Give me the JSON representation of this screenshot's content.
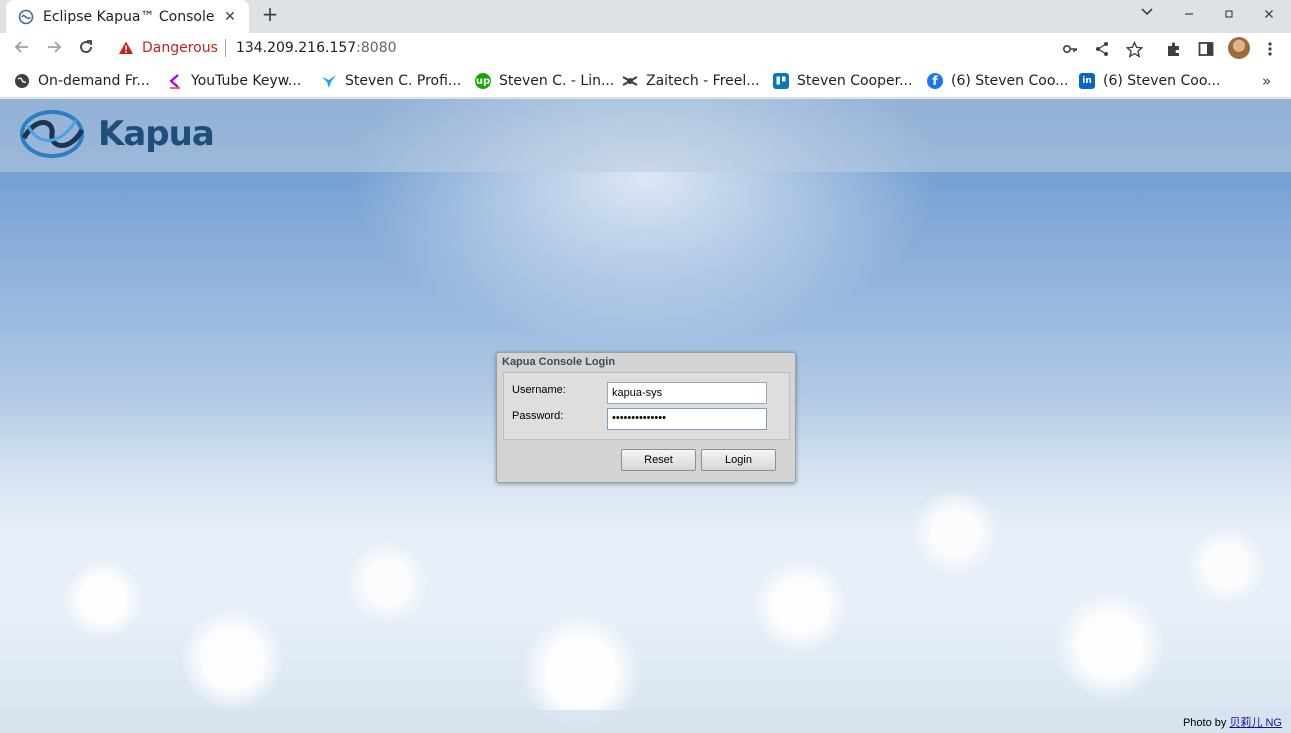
{
  "browser": {
    "tab_title": "Eclipse Kapua™ Console",
    "tab_close": "✕",
    "new_tab": "+",
    "security_label": "Dangerous",
    "url_host": "134.209.216.157",
    "url_port": ":8080"
  },
  "bookmarks": [
    {
      "label": "On-demand Fr...",
      "icon": "globe-icon",
      "color": "#3c4043"
    },
    {
      "label": "YouTube Keyw...",
      "icon": "keyword-icon",
      "color": "#a100ff"
    },
    {
      "label": "Steven C. Profi...",
      "icon": "bird-icon",
      "color": "#1da1f2"
    },
    {
      "label": "Steven C. - Lin...",
      "icon": "upwork-icon",
      "color": "#14a800"
    },
    {
      "label": "Zaitech - Freel...",
      "icon": "ninja-icon",
      "color": "#3c4043"
    },
    {
      "label": "Steven Cooper...",
      "icon": "trello-icon",
      "color": "#0079bf"
    },
    {
      "label": "(6) Steven Coo...",
      "icon": "facebook-icon",
      "color": "#1877f2"
    },
    {
      "label": "(6) Steven Coo...",
      "icon": "linkedin-icon",
      "color": "#0a66c2"
    }
  ],
  "bookmarks_more": "»",
  "app": {
    "logo_text": "Kapua"
  },
  "login": {
    "title": "Kapua Console Login",
    "username_label": "Username:",
    "username_value": "kapua-sys",
    "password_label": "Password:",
    "password_value": "••••••••••••••",
    "reset_label": "Reset",
    "login_label": "Login"
  },
  "credit": {
    "prefix": "Photo by ",
    "author": "贝莉儿 NG"
  }
}
